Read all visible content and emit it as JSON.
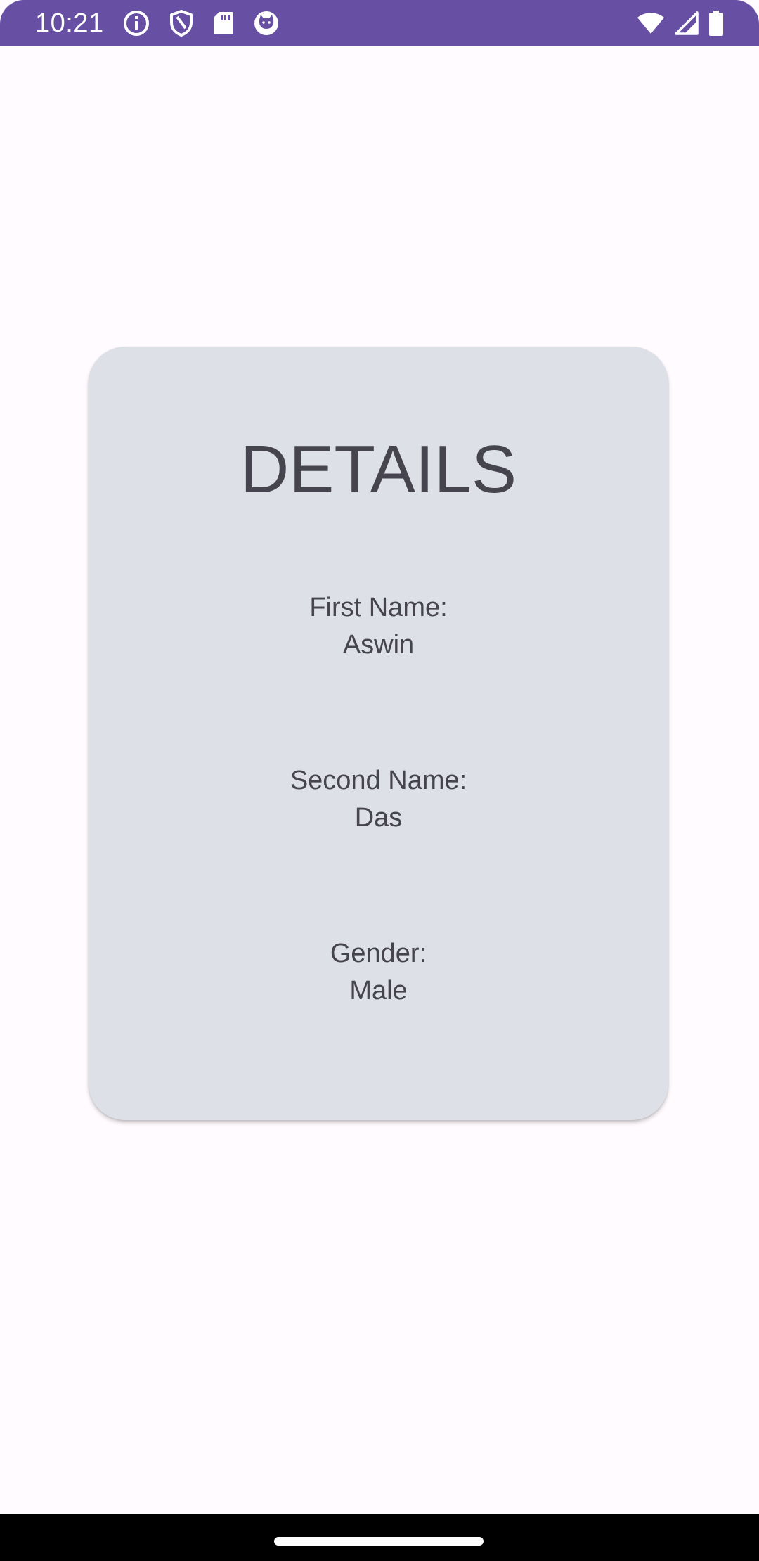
{
  "status_bar": {
    "time": "10:21",
    "background_color": "#6750A4",
    "left_icons": [
      "info-icon",
      "shield-icon",
      "sd-card-icon",
      "cat-face-icon"
    ],
    "right_icons": [
      "wifi-icon",
      "cell-signal-icon",
      "battery-icon"
    ]
  },
  "card": {
    "title": "DETAILS",
    "background_color": "#DEE0E7",
    "fields": [
      {
        "label": "First Name:",
        "value": "Aswin"
      },
      {
        "label": "Second Name:",
        "value": "Das"
      },
      {
        "label": "Gender:",
        "value": "Male"
      }
    ]
  },
  "colors": {
    "page_background": "#FFFBFE",
    "text": "#45444F",
    "nav_bar": "#000000"
  }
}
